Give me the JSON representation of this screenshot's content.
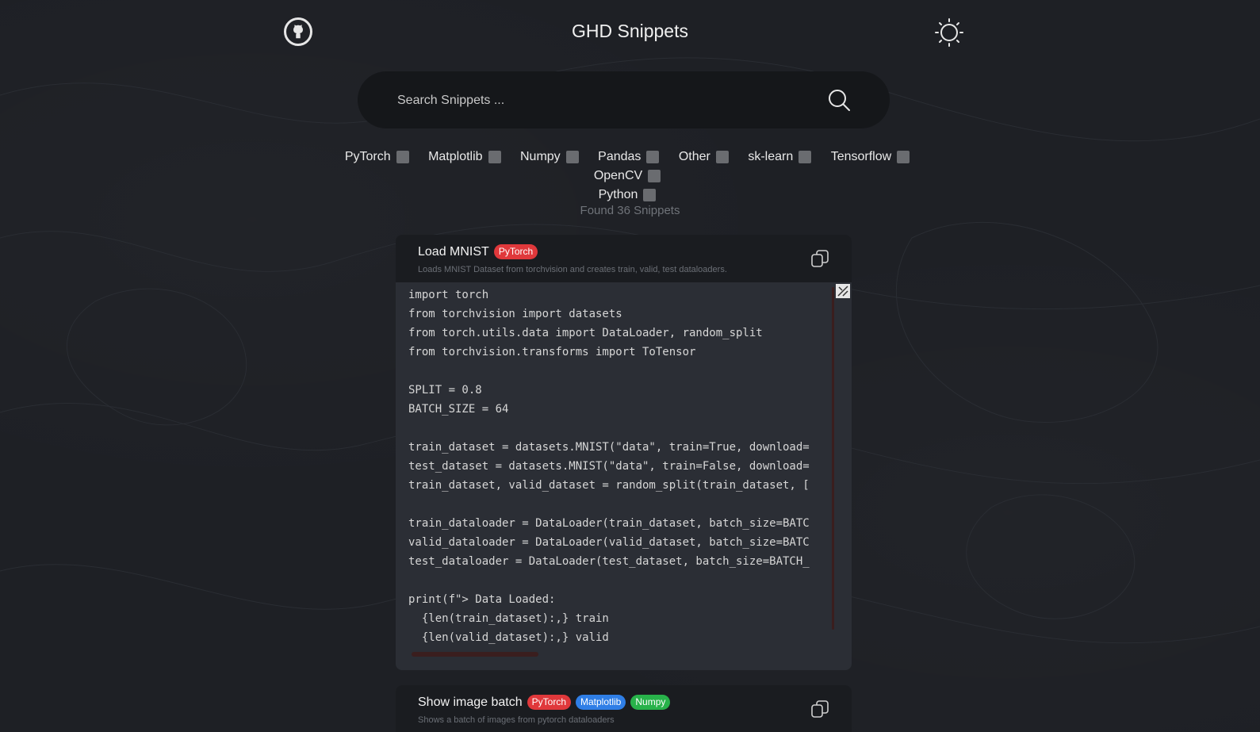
{
  "header": {
    "title": "GHD Snippets",
    "github_icon": "github-icon",
    "theme_icon": "sun-icon"
  },
  "search": {
    "placeholder": "Search Snippets ...",
    "value": ""
  },
  "filters": [
    {
      "label": "PyTorch"
    },
    {
      "label": "Matplotlib"
    },
    {
      "label": "Numpy"
    },
    {
      "label": "Pandas"
    },
    {
      "label": "Other"
    },
    {
      "label": "sk-learn"
    },
    {
      "label": "Tensorflow"
    },
    {
      "label": "OpenCV"
    },
    {
      "label": "Python"
    }
  ],
  "found_text": "Found 36 Snippets",
  "colors": {
    "pytorch": "#e0383b",
    "matplotlib": "#2f7ee6",
    "numpy": "#28b24a"
  },
  "snippets": [
    {
      "title": "Load MNIST",
      "tags": [
        "PyTorch"
      ],
      "description": "Loads MNIST Dataset from torchvision and creates train, valid, test dataloaders.",
      "code": "import torch\nfrom torchvision import datasets\nfrom torch.utils.data import DataLoader, random_split\nfrom torchvision.transforms import ToTensor\n\nSPLIT = 0.8\nBATCH_SIZE = 64\n\ntrain_dataset = datasets.MNIST(\"data\", train=True, download=\ntest_dataset = datasets.MNIST(\"data\", train=False, download=\ntrain_dataset, valid_dataset = random_split(train_dataset, [\n\ntrain_dataloader = DataLoader(train_dataset, batch_size=BATC\nvalid_dataloader = DataLoader(valid_dataset, batch_size=BATC\ntest_dataloader = DataLoader(test_dataset, batch_size=BATCH_\n\nprint(f\"> Data Loaded:\n  {len(train_dataset):,} train\n  {len(valid_dataset):,} valid"
    },
    {
      "title": "Show image batch",
      "tags": [
        "PyTorch",
        "Matplotlib",
        "Numpy"
      ],
      "description": "Shows a batch of images from pytorch dataloaders"
    }
  ]
}
